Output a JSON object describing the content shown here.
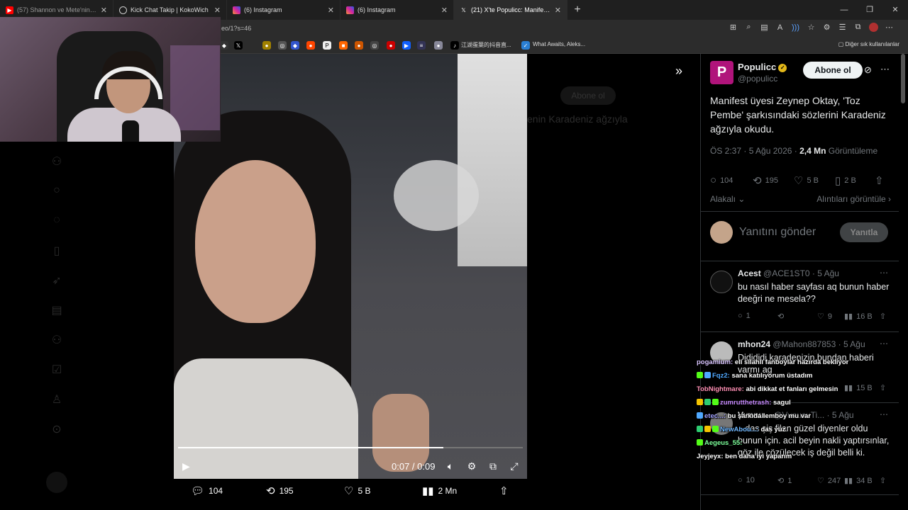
{
  "browser": {
    "tabs": [
      {
        "label": "(57) Shannon ve Mete'nin Karavan",
        "icon": "youtube-icon",
        "color": "#ff0000"
      },
      {
        "label": "Kick Chat Takip | KokoWich",
        "icon": "globe-icon",
        "color": "#cccccc"
      },
      {
        "label": "(6) Instagram",
        "icon": "instagram-icon",
        "color": "#d6249f"
      },
      {
        "label": "(6) Instagram",
        "icon": "instagram-icon",
        "color": "#d6249f"
      },
      {
        "label": "(21) X'te Populicc: Manifest üyesi",
        "icon": "x-icon",
        "color": "#ffffff"
      }
    ],
    "address": "eo/1?s=46",
    "bookmarks": [
      {
        "label": "江湖蛋葉的抖音直..."
      },
      {
        "label": "What Awaits, Aleks..."
      }
    ],
    "bookmarks_right": "Diğer sık kullanılanlar"
  },
  "video": {
    "time": "0:07 / 0:09",
    "progress": 0.77,
    "overlay_title": "enin Karadeniz ağzıyla",
    "overlay_button": "Abone ol",
    "actions": {
      "replies": "104",
      "reposts": "195",
      "likes": "5 B",
      "views": "2 Mn"
    }
  },
  "tweet": {
    "author_name": "Populicc",
    "author_handle": "@populicc",
    "subscribe_label": "Abone ol",
    "text": "Manifest üyesi Zeynep Oktay, 'Toz Pembe' şarkısındaki sözlerini Karadeniz ağzıyla okudu.",
    "time": "ÖS 2:37 · 5 Ağu 2026 · ",
    "views_count": "2,4 Mn",
    "views_label": " Görüntüleme",
    "stats": {
      "replies": "104",
      "reposts": "195",
      "likes": "5 B",
      "bookmarks": "2 B"
    },
    "related_label": "Alakalı",
    "quotes_label": "Alıntıları görüntüle",
    "reply_placeholder": "Yanıtını gönder",
    "reply_button": "Yanıtla"
  },
  "replies": [
    {
      "name": "Acest",
      "handle": "@ACE1ST0 · 5 Ağu",
      "text": "bu nasıl haber sayfası aq bunun haber deeğri ne mesela??",
      "replies": "1",
      "reposts": "",
      "likes": "9",
      "views": "16 B"
    },
    {
      "name": "mhon24",
      "handle": "@Mahon887853 · 5 Ağu",
      "text": "Didididi karadenizin bundan haberi varmı ag",
      "replies": "",
      "reposts": "",
      "likes": "",
      "views": "15 B"
    },
    {
      "name": "Vunnu...",
      "handle": "@VunucuTi... · 5 Ağu",
      "text": "...das şiş filan güzel diyenler oldu bunun için. acil beyin nakli yaptırsınlar, göz ile çözülecek iş değil belli ki.",
      "replies": "10",
      "reposts": "1",
      "likes": "247",
      "views": "34 B"
    }
  ],
  "chat": [
    {
      "user": "pogamium:",
      "msg": "eli silahlı fanboylar hazırda bekliyor",
      "color": "#d9c4ff"
    },
    {
      "user": "Fqz2:",
      "msg": "sana katılıyorum üstadım",
      "color": "#4fa8ff"
    },
    {
      "user": "TobNightmare:",
      "msg": "abi dikkat et fanları gelmesin",
      "color": "#ff8fb4"
    },
    {
      "user": "zumrutthetrash:",
      "msg": "sagul",
      "color": "#c88bff"
    },
    {
      "user": "etec...:",
      "msg": "bu şarkıda lemboy mu var",
      "color": "#a0a0ff"
    },
    {
      "user": "NewAbou...:",
      "msg": "das yüz",
      "color": "#6eb7ff"
    },
    {
      "user": "Aegeus_55:",
      "msg": "",
      "color": "#7cff9a"
    },
    {
      "user": "Jeyjeyx:",
      "msg": "ben daha iyi yaparım",
      "color": "#ffffff"
    }
  ]
}
